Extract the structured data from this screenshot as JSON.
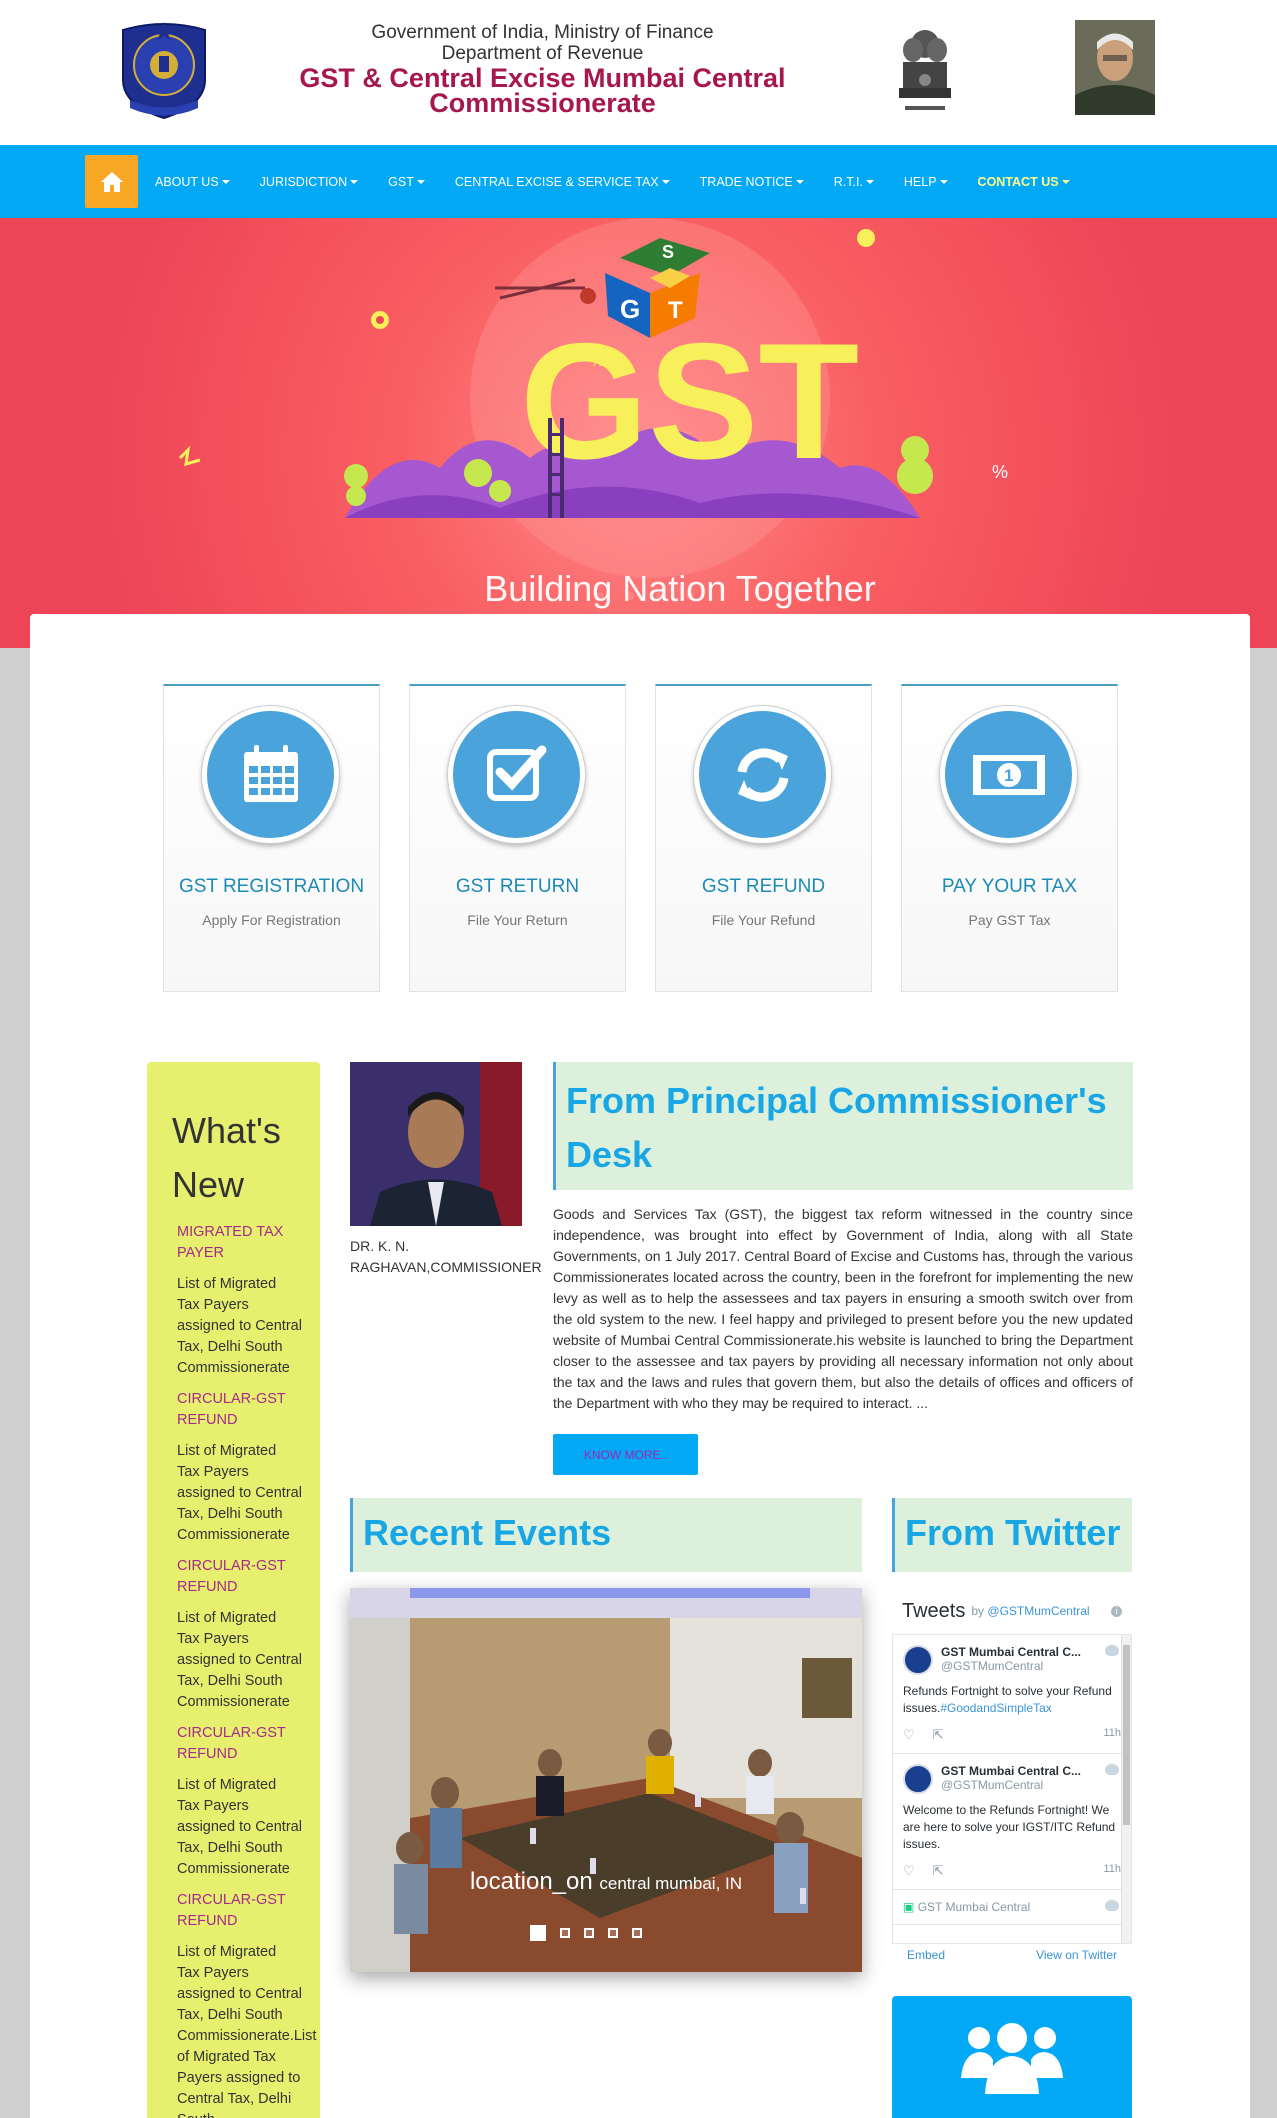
{
  "header": {
    "line1": "Government of India, Ministry of Finance",
    "line2": "Department of Revenue",
    "title": "GST & Central Excise Mumbai Central Commissionerate"
  },
  "nav": {
    "items": [
      {
        "label": "ABOUT US",
        "caret": true
      },
      {
        "label": "JURISDICTION",
        "caret": true
      },
      {
        "label": "GST",
        "caret": true
      },
      {
        "label": "CENTRAL EXCISE & SERVICE TAX",
        "caret": true
      },
      {
        "label": "TRADE NOTICE",
        "caret": true
      },
      {
        "label": "R.T.I.",
        "caret": true
      },
      {
        "label": "HELP",
        "caret": true
      },
      {
        "label": "CONTACT US",
        "caret": true
      }
    ]
  },
  "banner": {
    "caption": "Building Nation Together",
    "gst_word": "GST",
    "cube_letters": [
      "G",
      "S",
      "T"
    ],
    "percent": "%",
    "accent_red": "#ee4457",
    "accent_yellow": "#f7f05a"
  },
  "tiles": [
    {
      "title": "GST REGISTRATION",
      "sub": "Apply For Registration",
      "icon": "calendar-icon"
    },
    {
      "title": "GST RETURN",
      "sub": "File Your Return",
      "icon": "checkbox-icon"
    },
    {
      "title": "GST REFUND",
      "sub": "File Your Refund",
      "icon": "refresh-icon"
    },
    {
      "title": "PAY YOUR TAX",
      "sub": "Pay GST Tax",
      "icon": "money-icon"
    }
  ],
  "whatsnew": {
    "title": "What's New",
    "items": [
      {
        "link": "MIGRATED TAX PAYER",
        "text": "List of Migrated Tax Payers assigned to Central Tax, Delhi South Commissionerate"
      },
      {
        "link": "CIRCULAR-GST REFUND",
        "text": "List of Migrated Tax Payers assigned to Central Tax, Delhi South Commissionerate"
      },
      {
        "link": "CIRCULAR-GST REFUND",
        "text": "List of Migrated Tax Payers assigned to Central Tax, Delhi South Commissionerate"
      },
      {
        "link": "CIRCULAR-GST REFUND",
        "text": "List of Migrated Tax Payers assigned to Central Tax, Delhi South Commissionerate"
      },
      {
        "link": "CIRCULAR-GST REFUND",
        "text": "List of Migrated Tax Payers assigned to Central Tax, Delhi South Commissionerate.List of Migrated Tax Payers assigned to Central Tax, Delhi South"
      }
    ]
  },
  "commissioner": {
    "name": "DR. K. N. RAGHAVAN,COMMISSIONER",
    "heading": "From Principal Commissioner's Desk",
    "text": "Goods and Services Tax (GST), the biggest tax reform witnessed in the country since independence, was brought into effect by Government of India, along with all State Governments, on 1 July 2017. Central Board of Excise and Customs has, through the various Commissionerates located across the country, been in the forefront for implementing the new levy as well as to help the assessees and tax payers in ensuring a smooth switch over from the old system to the new. I feel happy and privileged to present before you the new updated website of Mumbai Central Commissionerate.his website is launched to bring the Department closer to the assessee and tax payers by providing all necessary information not only about the tax and the laws and rules that govern them, but also the details of offices and officers of the Department with who they may be required to interact. ...",
    "button": "KNOW MORE.."
  },
  "events": {
    "heading": "Recent Events",
    "location_icon_text": "location_on",
    "location": "central mumbai, IN",
    "slide_count": 5
  },
  "twitter": {
    "heading": "From Twitter",
    "widget_title": "Tweets",
    "by": "by",
    "handle_link": "@GSTMumCentral",
    "tweets": [
      {
        "name": "GST Mumbai Central C...",
        "handle": "@GSTMumCentral",
        "text": "Refunds Fortnight to solve your Refund issues.",
        "hashtag": "#GoodandSimpleTax",
        "time": "11h"
      },
      {
        "name": "GST Mumbai Central C...",
        "handle": "@GSTMumCentral",
        "text": "Welcome to the Refunds Fortnight! We are here to solve your IGST/ITC Refund issues.",
        "hashtag": "",
        "time": "11h"
      }
    ],
    "partial": "GST Mumbai Central",
    "embed": "Embed",
    "view": "View on Twitter"
  }
}
